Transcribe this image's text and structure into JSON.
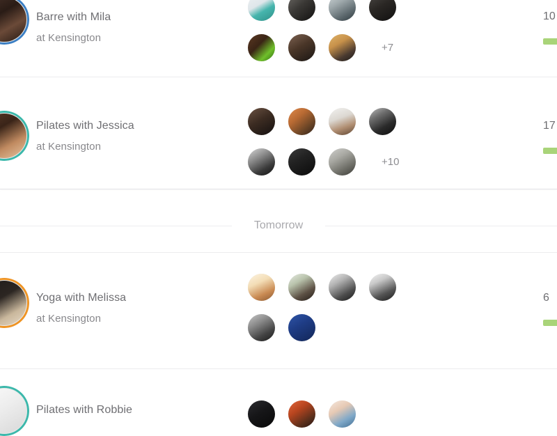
{
  "theme": {
    "page_background": "#ffffff",
    "title_color": "#6e6e72",
    "subtitle_color": "#88888c",
    "muted_color": "#a9a9ad",
    "divider_color": "#ececee",
    "progress_bar_color": "#a9d479"
  },
  "sections": [
    {
      "id": "today",
      "label": null,
      "classes": [
        {
          "id": "barre-mila",
          "title": "Barre with Mila",
          "location": "at Kensington",
          "instructor_ring_color": "#3b7fc4",
          "instructor_photo_name": "instructor-avatar-mila",
          "count": "10",
          "progress_color": "#a9d479",
          "attendee_rows": [
            [
              {
                "name": "attendee-avatar-1",
                "bg": "linear-gradient(150deg,#eef1f3 0%,#dfe6ea 40%,#46b5ad 62%,#2f8f88 100%)"
              },
              {
                "name": "attendee-avatar-2",
                "bg": "linear-gradient(140deg,#6d6a66 0%,#3a3835 45%,#121110 100%)"
              },
              {
                "name": "attendee-avatar-3",
                "bg": "linear-gradient(150deg,#cfd7d9 0%,#9fa9ac 35%,#5f6b70 70%,#2f3a3f 100%)"
              },
              {
                "name": "attendee-avatar-4",
                "bg": "linear-gradient(150deg,#4a4744 0%,#2a2724 45%,#111010 100%)"
              }
            ],
            [
              {
                "name": "attendee-avatar-5",
                "bg": "linear-gradient(135deg,#5d3a24 0%,#3a2415 40%,#6fbf2a 72%,#2f6b12 100%)"
              },
              {
                "name": "attendee-avatar-6",
                "bg": "linear-gradient(150deg,#7d6252 0%,#4a3628 45%,#1a1614 100%)"
              },
              {
                "name": "attendee-avatar-7",
                "bg": "linear-gradient(150deg,#e0b46a 0%,#c7914a 35%,#4a3a30 72%,#1d1a18 100%)"
              }
            ]
          ],
          "more_label": "+7"
        },
        {
          "id": "pilates-jessica",
          "title": "Pilates with Jessica",
          "location": "at Kensington",
          "instructor_ring_color": "#3bb8ab",
          "instructor_photo_name": "instructor-avatar-jessica",
          "count": "17",
          "progress_color": "#a9d479",
          "attendee_rows": [
            [
              {
                "name": "attendee-avatar-1",
                "bg": "linear-gradient(150deg,#6b5243 0%,#3c2c22 45%,#141010 100%)"
              },
              {
                "name": "attendee-avatar-2",
                "bg": "linear-gradient(140deg,#e08a4c 0%,#b86a33 35%,#6b4526 70%,#30211a 100%)"
              },
              {
                "name": "attendee-avatar-3",
                "bg": "linear-gradient(160deg,#f2f2f0 0%,#dcd8d2 38%,#b08e72 68%,#5d4430 100%)"
              },
              {
                "name": "attendee-avatar-4",
                "bg": "linear-gradient(150deg,#bdbdbd 0%,#6f6f6f 30%,#2a2a2a 65%,#0d0d0d 100%)"
              }
            ],
            [
              {
                "name": "attendee-avatar-5",
                "bg": "linear-gradient(150deg,#d8d8d8 0%,#8c8c8c 35%,#3a3a3a 70%,#111111 100%)"
              },
              {
                "name": "attendee-avatar-6",
                "bg": "linear-gradient(150deg,#3a3a3a 0%,#222222 40%,#0b0b0b 100%)"
              },
              {
                "name": "attendee-avatar-7",
                "bg": "linear-gradient(150deg,#cfcfcc 0%,#a8a8a2 35%,#6d6d66 70%,#3a3a36 100%)"
              }
            ]
          ],
          "more_label": "+10"
        }
      ]
    },
    {
      "id": "tomorrow",
      "label": "Tomorrow",
      "classes": [
        {
          "id": "yoga-melissa",
          "title": "Yoga with Melissa",
          "location": "at Kensington",
          "instructor_ring_color": "#ef9424",
          "instructor_photo_name": "instructor-avatar-melissa",
          "count": "6",
          "progress_color": "#a9d479",
          "attendee_rows": [
            [
              {
                "name": "attendee-avatar-1",
                "bg": "linear-gradient(155deg,#fdf4e2 0%,#f3ddb6 35%,#c98a52 70%,#8a5a33 100%)"
              },
              {
                "name": "attendee-avatar-2",
                "bg": "linear-gradient(150deg,#e8ece4 0%,#b9c3ac 32%,#5d5145 68%,#241d18 100%)"
              },
              {
                "name": "attendee-avatar-3",
                "bg": "linear-gradient(150deg,#efefef 0%,#b4b4b4 32%,#4d4d4d 70%,#1a1a1a 100%)"
              },
              {
                "name": "attendee-avatar-4",
                "bg": "linear-gradient(155deg,#f4f4f4 0%,#c9c9c9 30%,#545454 68%,#1c1c1c 100%)"
              }
            ],
            [
              {
                "name": "attendee-avatar-5",
                "bg": "linear-gradient(150deg,#c9c9c9 0%,#8a8a8a 35%,#434343 70%,#1b1b1b 100%)"
              },
              {
                "name": "attendee-avatar-6",
                "bg": "linear-gradient(150deg,#2f55a8 0%,#1f3d86 40%,#122657 100%)"
              }
            ]
          ],
          "more_label": null
        },
        {
          "id": "pilates-robbie",
          "title": "Pilates with Robbie",
          "location": "",
          "instructor_ring_color": "#3bb8ab",
          "instructor_photo_name": "instructor-avatar-robbie",
          "count": "",
          "progress_color": "#a9d479",
          "attendee_rows": [
            [
              {
                "name": "attendee-avatar-1",
                "bg": "linear-gradient(150deg,#2b2b2f 0%,#161618 45%,#090909 100%)"
              },
              {
                "name": "attendee-avatar-2",
                "bg": "linear-gradient(145deg,#e2673c 0%,#b8451f 35%,#5a2f1c 72%,#251310 100%)"
              },
              {
                "name": "attendee-avatar-3",
                "bg": "linear-gradient(150deg,#f6e8de 0%,#e6c9b4 35%,#7fa8c8 68%,#3f6c92 100%)"
              }
            ]
          ],
          "more_label": null
        }
      ]
    }
  ]
}
